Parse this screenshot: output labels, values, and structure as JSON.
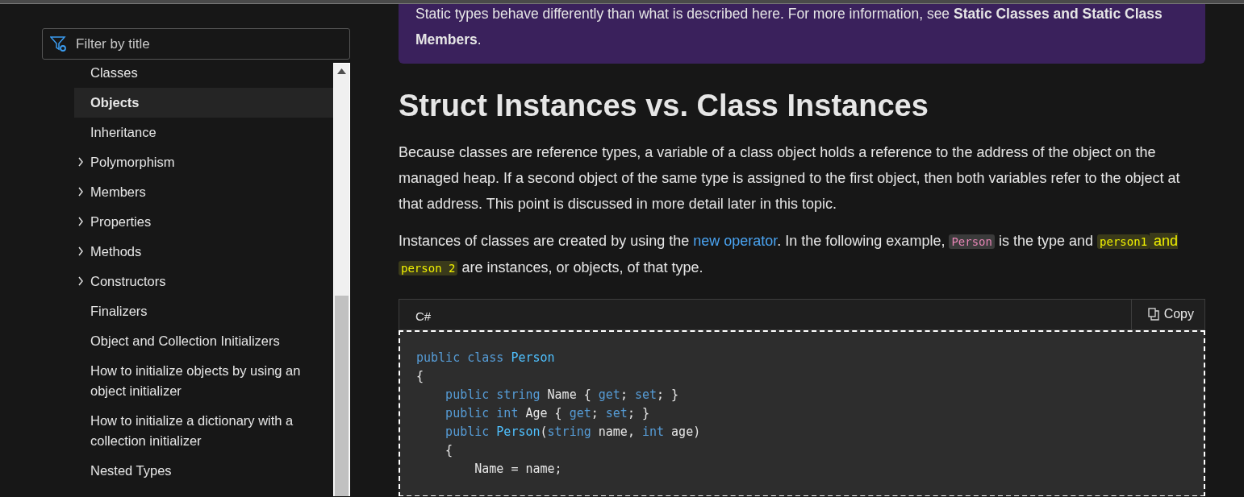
{
  "sidebar": {
    "filter": {
      "placeholder": "Filter by title"
    },
    "items": [
      {
        "label": "Classes",
        "expandable": false,
        "selected": false
      },
      {
        "label": "Objects",
        "expandable": false,
        "selected": true
      },
      {
        "label": "Inheritance",
        "expandable": false,
        "selected": false
      },
      {
        "label": "Polymorphism",
        "expandable": true,
        "expanded": false,
        "selected": false
      },
      {
        "label": "Members",
        "expandable": true,
        "expanded": false,
        "selected": false
      },
      {
        "label": "Properties",
        "expandable": true,
        "expanded": false,
        "selected": false
      },
      {
        "label": "Methods",
        "expandable": true,
        "expanded": false,
        "selected": false
      },
      {
        "label": "Constructors",
        "expandable": true,
        "expanded": false,
        "selected": false
      },
      {
        "label": "Finalizers",
        "expandable": false,
        "selected": false
      },
      {
        "label": "Object and Collection Initializers",
        "expandable": false,
        "selected": false
      },
      {
        "label": "How to initialize objects by using an object initializer",
        "expandable": false,
        "selected": false
      },
      {
        "label": "How to initialize a dictionary with a collection initializer",
        "expandable": false,
        "selected": false
      },
      {
        "label": "Nested Types",
        "expandable": false,
        "selected": false
      }
    ]
  },
  "note": {
    "text": "Static types behave differently than what is described here. For more information, see **Static Classes and Static Class Members**."
  },
  "heading": "Struct Instances vs. Class Instances",
  "paragraphs": [
    [
      {
        "kind": "text",
        "text": "Because classes are reference types, a variable of a class object holds a reference to the address of the object on the managed heap. If a second object of the same type is assigned to the first object, then both variables refer to the object at that address. This point is discussed in more detail later in this topic."
      }
    ],
    [
      {
        "kind": "text",
        "text": "Instances of classes are created by using the "
      },
      {
        "kind": "link",
        "text": "new operator"
      },
      {
        "kind": "text",
        "text": ". In the following example, "
      },
      {
        "kind": "code",
        "text": "Person",
        "highlighted": false
      },
      {
        "kind": "text",
        "text": " is the type and "
      },
      {
        "kind": "code",
        "text": "person1",
        "highlighted": true
      },
      {
        "kind": "text",
        "text": " and ",
        "highlighted": true
      },
      {
        "kind": "code",
        "text": "person 2",
        "highlighted": true
      },
      {
        "kind": "text",
        "text": " are instances, or objects, of that type."
      }
    ]
  ],
  "code_block": {
    "language": "C#",
    "copy_label": "Copy",
    "focused": true,
    "lines": [
      [
        {
          "kind": "keyword",
          "text": "public class "
        },
        {
          "kind": "type",
          "text": "Person"
        }
      ],
      [
        {
          "kind": "plain",
          "text": "{"
        }
      ],
      [
        {
          "kind": "keyword",
          "text": "    public string "
        },
        {
          "kind": "plain",
          "text": "Name { "
        },
        {
          "kind": "keyword",
          "text": "get"
        },
        {
          "kind": "plain",
          "text": "; "
        },
        {
          "kind": "keyword",
          "text": "set"
        },
        {
          "kind": "plain",
          "text": "; }"
        }
      ],
      [
        {
          "kind": "keyword",
          "text": "    public int "
        },
        {
          "kind": "plain",
          "text": "Age { "
        },
        {
          "kind": "keyword",
          "text": "get"
        },
        {
          "kind": "plain",
          "text": "; "
        },
        {
          "kind": "keyword",
          "text": "set"
        },
        {
          "kind": "plain",
          "text": "; }"
        }
      ],
      [
        {
          "kind": "keyword",
          "text": "    public "
        },
        {
          "kind": "type",
          "text": "Person"
        },
        {
          "kind": "plain",
          "text": "("
        },
        {
          "kind": "keyword",
          "text": "string "
        },
        {
          "kind": "plain",
          "text": "name, "
        },
        {
          "kind": "keyword",
          "text": "int "
        },
        {
          "kind": "plain",
          "text": "age)"
        }
      ],
      [
        {
          "kind": "plain",
          "text": "    {"
        }
      ],
      [
        {
          "kind": "plain",
          "text": "        Name = name;"
        }
      ]
    ]
  }
}
